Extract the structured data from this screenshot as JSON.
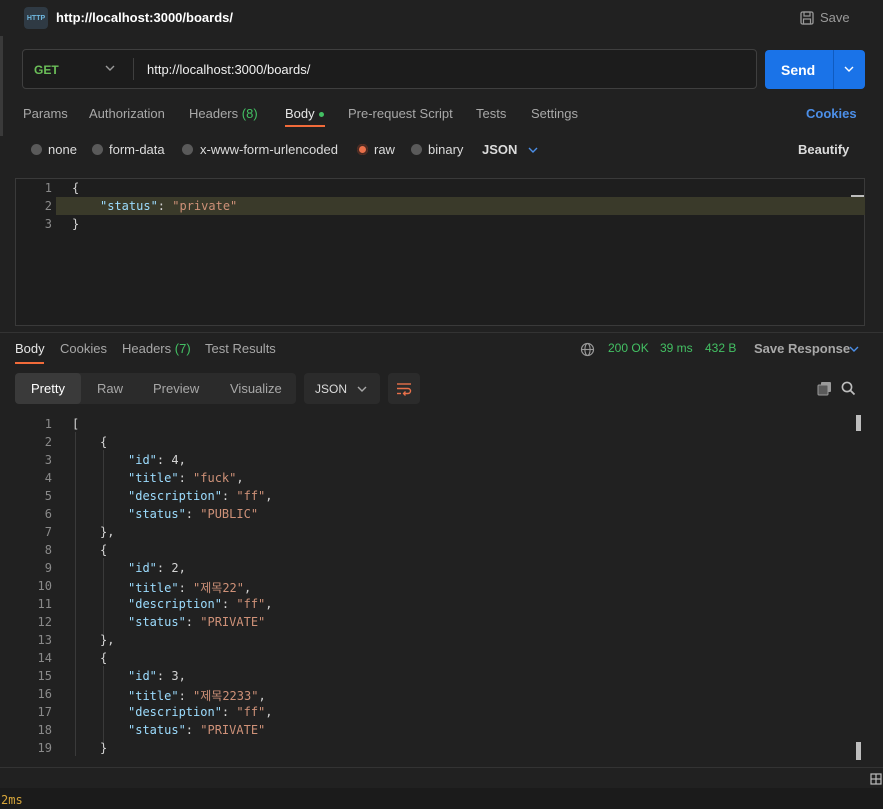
{
  "header": {
    "title": "http://localhost:3000/boards/",
    "save_label": "Save",
    "icon": "http-icon"
  },
  "request": {
    "method": "GET",
    "url": "http://localhost:3000/boards/",
    "send_label": "Send"
  },
  "request_tabs": {
    "params": "Params",
    "authorization": "Authorization",
    "headers": "Headers",
    "headers_count": "(8)",
    "body": "Body",
    "pre_request": "Pre-request Script",
    "tests": "Tests",
    "settings": "Settings",
    "cookies": "Cookies"
  },
  "body_types": {
    "none": "none",
    "form_data": "form-data",
    "urlencoded": "x-www-form-urlencoded",
    "raw": "raw",
    "binary": "binary",
    "format": "JSON",
    "beautify": "Beautify",
    "selected": "raw"
  },
  "request_body": {
    "lines": [
      "1",
      "2",
      "3"
    ],
    "open": "{",
    "key": "\"status\"",
    "colon": ": ",
    "value": "\"private\"",
    "close": "}"
  },
  "response_tabs": {
    "body": "Body",
    "cookies": "Cookies",
    "headers": "Headers",
    "headers_count": "(7)",
    "test_results": "Test Results"
  },
  "response_meta": {
    "status": "200 OK",
    "time": "39 ms",
    "size": "432 B",
    "save_response": "Save Response"
  },
  "view_modes": {
    "pretty": "Pretty",
    "raw": "Raw",
    "preview": "Preview",
    "visualize": "Visualize",
    "format": "JSON"
  },
  "response_body": {
    "line_numbers": [
      "1",
      "2",
      "3",
      "4",
      "5",
      "6",
      "7",
      "8",
      "9",
      "10",
      "11",
      "12",
      "13",
      "14",
      "15",
      "16",
      "17",
      "18",
      "19"
    ],
    "open_bracket": "[",
    "items": [
      {
        "id": "4",
        "title": "\"fuck\"",
        "description": "\"ff\"",
        "status": "\"PUBLIC\""
      },
      {
        "id": "2",
        "title": "\"제목22\"",
        "description": "\"ff\"",
        "status": "\"PRIVATE\""
      },
      {
        "id": "3",
        "title": "\"제목2233\"",
        "description": "\"ff\"",
        "status": "\"PRIVATE\""
      }
    ],
    "keys": {
      "id": "\"id\"",
      "title": "\"title\"",
      "description": "\"description\"",
      "status": "\"status\""
    }
  },
  "footer": {
    "timing": "2ms"
  }
}
